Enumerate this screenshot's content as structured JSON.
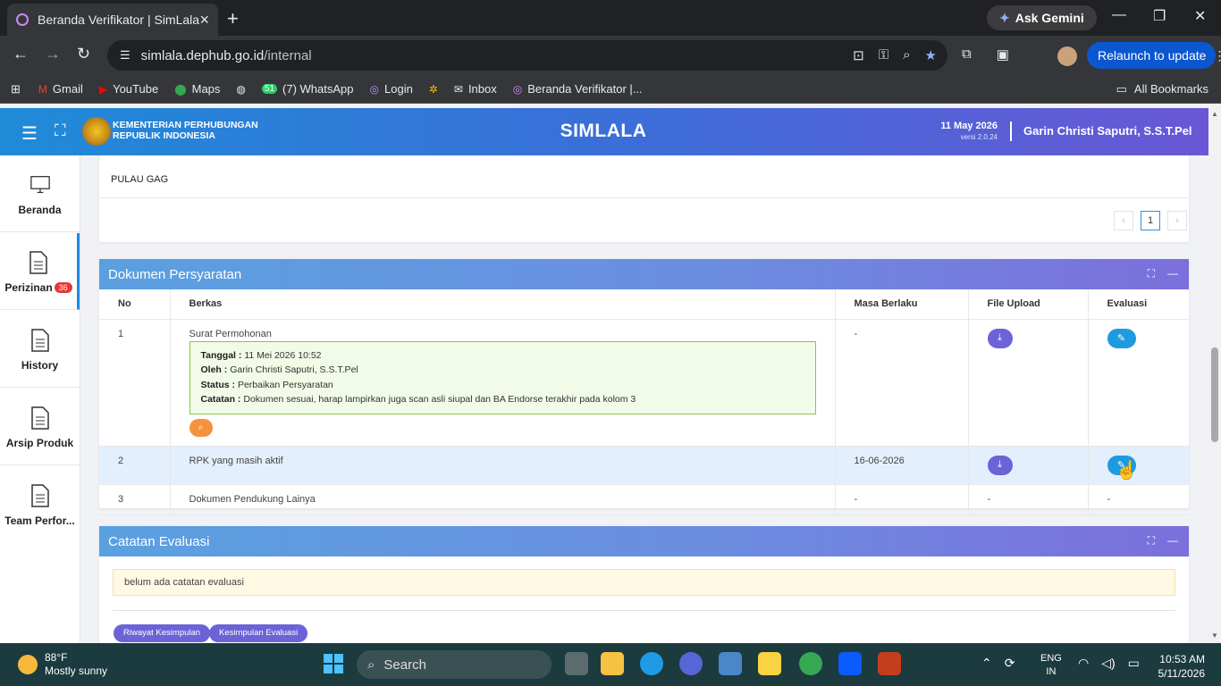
{
  "browser": {
    "tab_title": "Beranda Verifikator | SimLala",
    "ask_gemini": "Ask Gemini",
    "url_domain": "simlala.dephub.go.id",
    "url_path": "/internal",
    "relaunch": "Relaunch to update",
    "bookmarks": [
      "Gmail",
      "YouTube",
      "Maps",
      "(7) WhatsApp",
      "Login",
      "Inbox",
      "Beranda Verifikator |..."
    ],
    "whatsapp_count": "51",
    "all_bookmarks": "All Bookmarks"
  },
  "header": {
    "ministry_line1": "KEMENTERIAN PERHUBUNGAN",
    "ministry_line2": "REPUBLIK INDONESIA",
    "app_name": "SIMLALA",
    "date": "11 May 2026",
    "version": "versi 2.0.24",
    "user": "Garin Christi Saputri, S.S.T.Pel"
  },
  "sidebar": {
    "items": [
      {
        "label": "Beranda",
        "icon": "monitor-icon"
      },
      {
        "label": "Perizinan",
        "icon": "document-icon",
        "badge": "36"
      },
      {
        "label": "History",
        "icon": "document-icon"
      },
      {
        "label": "Arsip Produk",
        "icon": "document-icon"
      },
      {
        "label": "Team Perfor...",
        "icon": "document-icon"
      }
    ]
  },
  "top_card": {
    "row_text": "PULAU GAG",
    "pager": {
      "prev": "‹",
      "page": "1",
      "next": "›"
    }
  },
  "dokumen": {
    "title": "Dokumen Persyaratan",
    "columns": [
      "No",
      "Berkas",
      "Masa Berlaku",
      "File Upload",
      "Evaluasi"
    ],
    "rows": [
      {
        "no": "1",
        "berkas": "Surat Permohonan",
        "masa": "-",
        "eval": {
          "tanggal_label": "Tanggal :",
          "tanggal": "11 Mei 2026 10:52",
          "oleh_label": "Oleh :",
          "oleh": "Garin Christi Saputri, S.S.T.Pel",
          "status_label": "Status :",
          "status": "Perbaikan Persyaratan",
          "catatan_label": "Catatan :",
          "catatan": "Dokumen sesuai, harap lampirkan juga scan asli siupal dan BA Endorse terakhir pada kolom 3"
        }
      },
      {
        "no": "2",
        "berkas": "RPK yang masih aktif",
        "masa": "16-06-2026"
      },
      {
        "no": "3",
        "berkas": "Dokumen Pendukung Lainya",
        "masa": "-",
        "upload": "-",
        "evaluasi": "-"
      }
    ]
  },
  "catatan": {
    "title": "Catatan Evaluasi",
    "note": "belum ada catatan evaluasi",
    "btn_riwayat": "Riwayat Kesimpulan",
    "btn_kesimpulan": "Kesimpulan Evaluasi"
  },
  "taskbar": {
    "temp": "88°F",
    "weather": "Mostly sunny",
    "search": "Search",
    "lang1": "ENG",
    "lang2": "IN",
    "time": "10:53 AM",
    "date": "5/11/2026"
  }
}
